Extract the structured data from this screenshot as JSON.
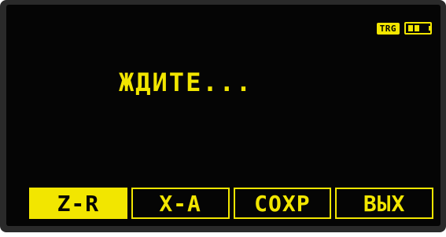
{
  "status": {
    "badge": "TRG",
    "battery_icon": "battery-icon",
    "battery_level": 0.67
  },
  "message": "ЖДИТЕ...",
  "softkeys": [
    {
      "label": "Z-R",
      "active": true
    },
    {
      "label": "X-A",
      "active": false
    },
    {
      "label": "СОХР",
      "active": false
    },
    {
      "label": "ВЫХ",
      "active": false
    }
  ],
  "colors": {
    "foreground": "#f2e600",
    "background": "#050505"
  }
}
